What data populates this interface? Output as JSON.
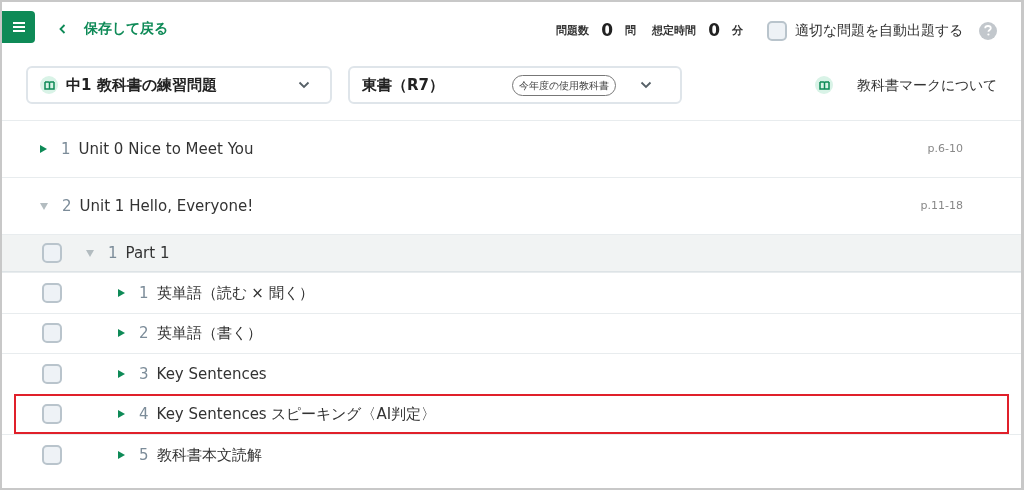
{
  "header": {
    "back_label": "保存して戻る",
    "stats": [
      {
        "label": "問題数",
        "value": "0",
        "unit": "問"
      },
      {
        "label": "想定時間",
        "value": "0",
        "unit": "分"
      }
    ],
    "auto_select": {
      "label": "適切な問題を自動出題する",
      "checked": false
    }
  },
  "selectors": [
    {
      "kind": "course",
      "value": "中1 教科書の練習問題"
    },
    {
      "kind": "textbook",
      "value": "東書（R7）",
      "badge": "今年度の使用教科書"
    }
  ],
  "textbook_mark_link": "教科書マークについて",
  "units": [
    {
      "number": "1",
      "title": "Unit 0 Nice to Meet You",
      "pages": "p.6-10",
      "expanded": false
    },
    {
      "number": "2",
      "title": "Unit 1 Hello, Everyone!",
      "pages": "p.11-18",
      "expanded": true,
      "children": [
        {
          "number": "1",
          "title": "Part 1",
          "checked": false,
          "expanded": true,
          "children": [
            {
              "number": "1",
              "title": "英単語（読む × 聞く）",
              "checked": false,
              "expanded": false,
              "highlighted": false
            },
            {
              "number": "2",
              "title": "英単語（書く）",
              "checked": false,
              "expanded": false,
              "highlighted": false
            },
            {
              "number": "3",
              "title": "Key Sentences",
              "checked": false,
              "expanded": false,
              "highlighted": false
            },
            {
              "number": "4",
              "title": "Key Sentences スピーキング〈AI判定〉",
              "checked": false,
              "expanded": false,
              "highlighted": true
            },
            {
              "number": "5",
              "title": "教科書本文読解",
              "checked": false,
              "expanded": false,
              "highlighted": false
            }
          ]
        }
      ]
    }
  ]
}
